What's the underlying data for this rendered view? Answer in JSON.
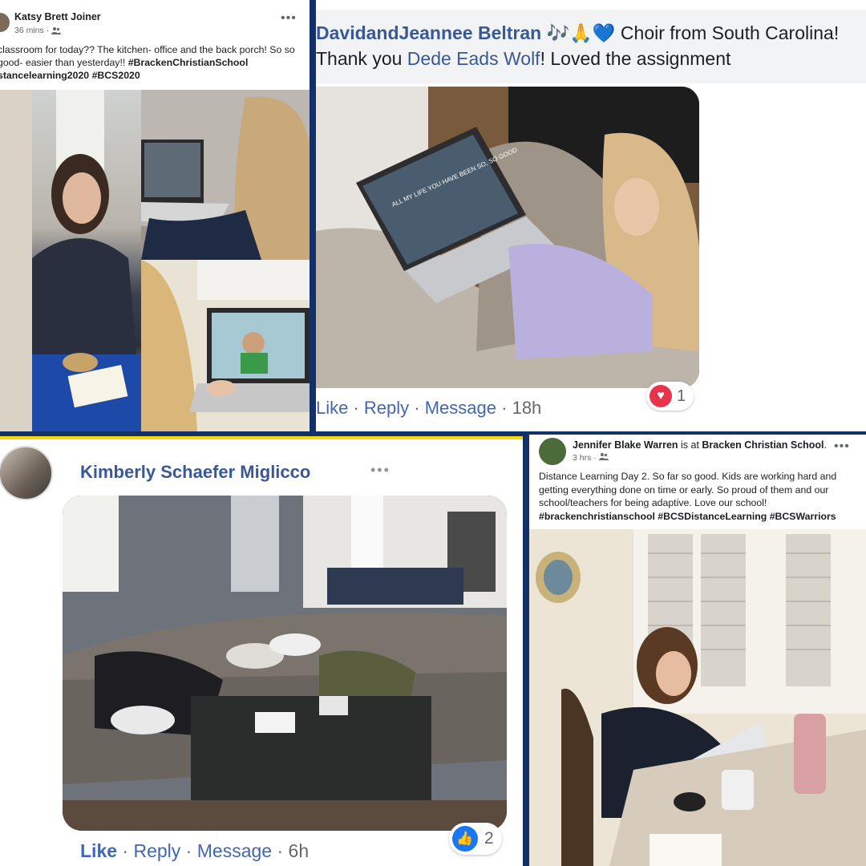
{
  "colors": {
    "navy_divider": "#14306b",
    "yellow_accent": "#f5d90a",
    "fb_blue": "#385898",
    "link_blue": "#4267b2",
    "header_gray": "#f2f3f5"
  },
  "post1": {
    "author": "Katsy Brett Joiner",
    "time": "36 mins",
    "audience_icon": "friends-icon",
    "more_icon": "more-dots-icon",
    "text_plain": "classroom for today?? The kitchen- office and the back porch! So so good- easier than yesterday!! ",
    "hashtag1": "#BrackenChristianSchool",
    "text_line3": "stancelearning2020 #BCS2020"
  },
  "post2": {
    "author": "DavidandJeannee Beltran",
    "emoji": "🎶🙏💙",
    "comment_part1": " Choir from South Carolina!",
    "thanks_prefix": "Thank you ",
    "mention": "Dede Eads Wolf",
    "thanks_suffix": "! Loved the assignment",
    "actions": {
      "like": "Like",
      "reply": "Reply",
      "message": "Message",
      "sep": " · ",
      "time": "18h"
    },
    "reaction_icon": "heart-reaction-icon",
    "reaction_count": "1"
  },
  "post3": {
    "author": "Kimberly Schaefer Miglicco",
    "more_icon": "more-dots-icon",
    "actions": {
      "like": "Like",
      "reply": "Reply",
      "message": "Message",
      "sep": " · ",
      "time": "6h"
    },
    "reaction_icon": "thumbs-up-reaction-icon",
    "reaction_count": "2"
  },
  "post4": {
    "author": "Jennifer Blake Warren",
    "is_at": " is at ",
    "place": "Bracken Christian School",
    "period": ".",
    "time": "3 hrs",
    "text_plain": "Distance Learning Day 2. So far so good. Kids are working hard and getting everything done on time or early. So proud of them and our school/teachers for being adaptive. Love our school! ",
    "hashtags": "#brackenchristianschool  #BCSDistanceLearning #BCSWarriors"
  }
}
